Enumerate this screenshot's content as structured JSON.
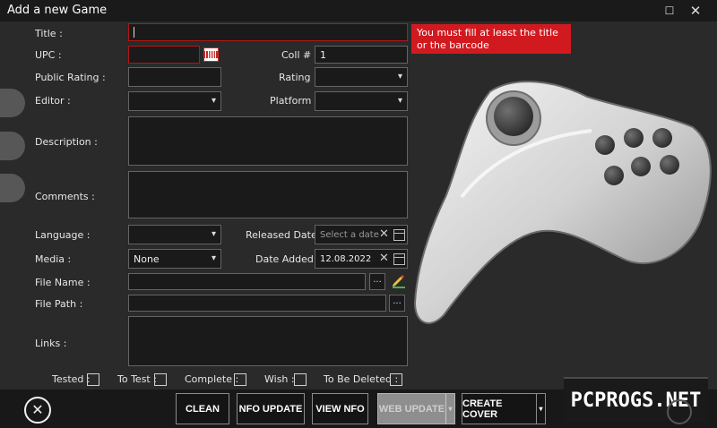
{
  "window": {
    "title": "Add a new Game",
    "maximize_icon": "maximize-icon",
    "close_icon": "close-icon"
  },
  "form": {
    "title_label": "Title :",
    "title_value": "",
    "upc_label": "UPC :",
    "upc_value": "",
    "coll_label": "Coll # :",
    "coll_value": "1",
    "public_rating_label": "Public Rating :",
    "public_rating_value": "",
    "rating_label": "Rating :",
    "rating_value": "",
    "editor_label": "Editor :",
    "editor_value": "",
    "platform_label": "Platform :",
    "platform_value": "",
    "description_label": "Description :",
    "description_value": "",
    "comments_label": "Comments :",
    "comments_value": "",
    "language_label": "Language :",
    "language_value": "",
    "released_label": "Released Date :",
    "released_placeholder": "Select a date",
    "media_label": "Media :",
    "media_value": "None",
    "date_added_label": "Date Added :",
    "date_added_value": "12.08.2022",
    "file_name_label": "File Name :",
    "file_name_value": "",
    "file_path_label": "File Path :",
    "file_path_value": "",
    "links_label": "Links :",
    "links_value": "",
    "browse_label": "...",
    "checkboxes": [
      {
        "label": "Tested :",
        "checked": false
      },
      {
        "label": "To Test :",
        "checked": false
      },
      {
        "label": "Complete :",
        "checked": false
      },
      {
        "label": "Wish :",
        "checked": false
      },
      {
        "label": "To Be Deleted :",
        "checked": false
      }
    ]
  },
  "error": {
    "message": "You must fill at least the title or the barcode",
    "color": "#d11a1f"
  },
  "buttons": {
    "close_symbol": "✕",
    "clean": "CLEAN",
    "nfo_update": "NFO UPDATE",
    "view_nfo": "VIEW NFO",
    "web_update": "WEB UPDATE",
    "create_cover": "CREATE COVER",
    "dropdown_glyph": "▾",
    "clear_glyph": "✕"
  },
  "watermark": {
    "text": "PCPROGS.NET"
  },
  "icons": [
    "barcode-icon",
    "calendar-icon",
    "pencil-icon",
    "gamepad-icon",
    "chevron-down-icon"
  ]
}
